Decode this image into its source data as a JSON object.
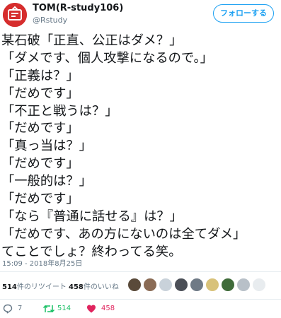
{
  "user": {
    "display_name": "TOM(R-study106)",
    "handle": "@Rstudy"
  },
  "follow_button": {
    "label": "フォローする"
  },
  "tweet": {
    "lines": [
      "某石破「正直、公正はダメ？」",
      "「ダメです、個人攻撃になるので。」",
      "「正義は？」",
      "「だめです」",
      "「不正と戦うは？」",
      "「だめです」",
      "「真っ当は？」",
      "「だめです」",
      "「一般的は？」",
      "「だめです」",
      "「なら『普通に話せる』は？」",
      "「だめです、あの方にないのは全てダメ」",
      "てことでしょ？終わってる笑。"
    ],
    "timestamp": "15:09 - 2018年8月25日"
  },
  "stats": {
    "retweets_count": "514",
    "retweets_suffix": "件のリツイート",
    "likes_count": "458",
    "likes_suffix": "件のいいね"
  },
  "likers": [
    {
      "icon": "liker-avatar",
      "color": "#5a4a3a"
    },
    {
      "icon": "liker-avatar",
      "color": "#8a6b55"
    },
    {
      "icon": "liker-avatar",
      "color": "#c9d2da"
    },
    {
      "icon": "liker-avatar",
      "color": "#4b4f57"
    },
    {
      "icon": "liker-avatar",
      "color": "#6f7a86"
    },
    {
      "icon": "liker-avatar",
      "color": "#d8c27a"
    },
    {
      "icon": "liker-avatar",
      "color": "#3f6b3a"
    },
    {
      "icon": "liker-avatar",
      "color": "#b8c0c8"
    },
    {
      "icon": "liker-avatar",
      "color": "#e8ecef"
    }
  ],
  "actions": {
    "reply_count": "7",
    "retweet_count": "514",
    "like_count": "458"
  },
  "colors": {
    "accent": "#1da1f2",
    "retweet": "#17bf63",
    "like": "#e0245e",
    "secondary_text": "#657786",
    "avatar_bg": "#d62d2d"
  }
}
